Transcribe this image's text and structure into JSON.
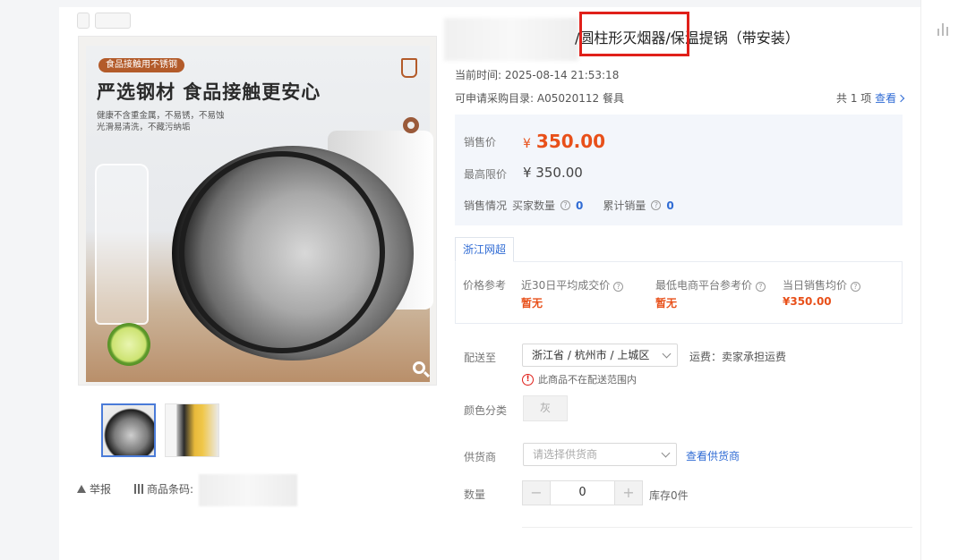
{
  "product": {
    "title": "/圆柱形灭烟器/保温提锅（带安装）"
  },
  "gallery": {
    "badge": "食品接触用不锈钢",
    "headline": "严选钢材  食品接触更安心",
    "subtext_1": "健康不含重金属，不易锈，不易蚀",
    "subtext_2": "光滑易清洗，不藏污纳垢"
  },
  "footer_left": {
    "report_label": "举报",
    "barcode_label": "商品条码:"
  },
  "meta": {
    "time_label": "当前时间:",
    "time_value": "2025-08-14 21:53:18",
    "catalog_label": "可申请采购目录:",
    "catalog_value": "A05020112 餐具",
    "count_text": "共 1 项",
    "view_label": "查看"
  },
  "pricing": {
    "sale_label": "销售价",
    "currency": "¥",
    "sale_value": "350.00",
    "max_label": "最高限价",
    "max_value": "¥ 350.00",
    "sales_label": "销售情况",
    "buyers_label": "买家数量",
    "buyers_value": "0",
    "total_label": "累计销量",
    "total_value": "0"
  },
  "reference": {
    "tab_label": "浙江网超",
    "row_label": "价格参考",
    "col1_label": "近30日平均成交价",
    "col1_value": "暂无",
    "col2_label": "最低电商平台参考价",
    "col2_value": "暂无",
    "col3_label": "当日销售均价",
    "col3_value": "¥350.00"
  },
  "delivery": {
    "label": "配送至",
    "region": "浙江省 / 杭州市 / 上城区",
    "freight": "运费：卖家承担运费",
    "warning": "此商品不在配送范围内"
  },
  "color": {
    "label": "颜色分类",
    "option": "灰"
  },
  "supplier": {
    "label": "供货商",
    "placeholder": "请选择供货商",
    "link": "查看供货商"
  },
  "quantity": {
    "label": "数量",
    "minus": "−",
    "value": "0",
    "plus": "+",
    "stock": "库存0件"
  },
  "colors": {
    "accent_blue": "#2f6bd4",
    "price_red": "#e8501a",
    "highlight_box": "#e0201a"
  }
}
